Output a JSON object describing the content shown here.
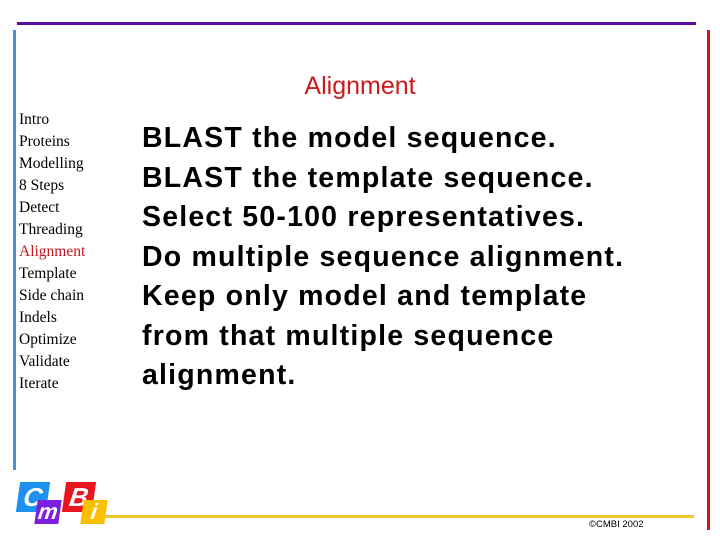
{
  "slide": {
    "title": "Alignment",
    "nav": [
      {
        "label": "Intro",
        "active": false
      },
      {
        "label": "Proteins",
        "active": false
      },
      {
        "label": "Modelling",
        "active": false
      },
      {
        "label": "8 Steps",
        "active": false
      },
      {
        "label": "Detect",
        "active": false
      },
      {
        "label": "Threading",
        "active": false
      },
      {
        "label": "Alignment",
        "active": true
      },
      {
        "label": "Template",
        "active": false
      },
      {
        "label": "Side chain",
        "active": false
      },
      {
        "label": "Indels",
        "active": false
      },
      {
        "label": "Optimize",
        "active": false
      },
      {
        "label": "Validate",
        "active": false
      },
      {
        "label": "Iterate",
        "active": false
      }
    ],
    "body_lines": [
      "BLAST the model sequence.",
      "BLAST the template sequence.",
      "Select 50-100 representatives.",
      "Do multiple sequence alignment.",
      "Keep only model and template",
      "from that multiple sequence",
      "alignment."
    ],
    "logo": {
      "letters": [
        "C",
        "m",
        "B",
        "i"
      ]
    },
    "copyright": "©CMBI 2002",
    "colors": {
      "title": "#cc1a1a",
      "active_nav": "#c0161e",
      "top_rule": "#5a0fa0",
      "left_rule": "#4a90d9",
      "right_rule": "#cc1a1a",
      "bottom_rule": "#f0c830"
    }
  }
}
